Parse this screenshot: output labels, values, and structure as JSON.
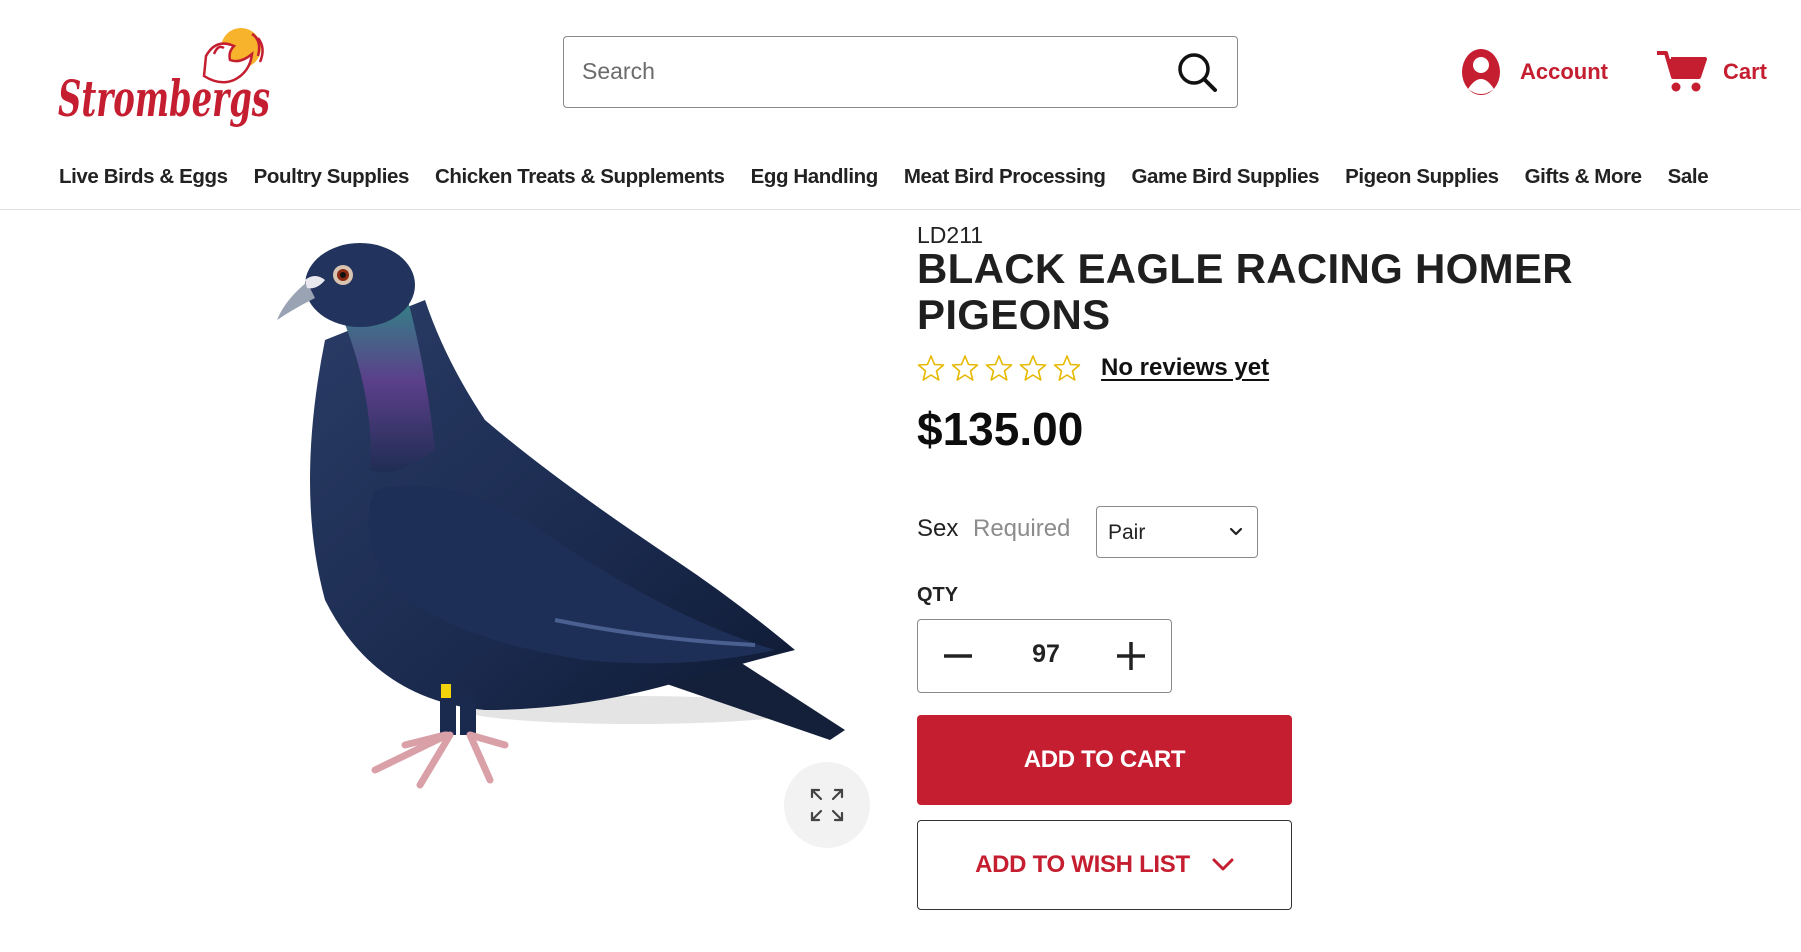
{
  "header": {
    "logo_text": "Strombergs",
    "search": {
      "placeholder": "Search"
    },
    "account_label": "Account",
    "cart_label": "Cart"
  },
  "nav": {
    "items": [
      "Live Birds & Eggs",
      "Poultry Supplies",
      "Chicken Treats & Supplements",
      "Egg Handling",
      "Meat Bird Processing",
      "Game Bird Supplies",
      "Pigeon Supplies",
      "Gifts & More",
      "Sale"
    ]
  },
  "product": {
    "sku": "LD211",
    "title": "BLACK EAGLE RACING HOMER PIGEONS",
    "rating": {
      "stars_filled": 0,
      "stars_total": 5,
      "reviews_text": "No reviews yet"
    },
    "price": "$135.00",
    "image_icon": "pigeon-image",
    "options": {
      "sex_label": "Sex",
      "sex_required": "Required",
      "sex_selected": "Pair"
    },
    "qty_label": "QTY",
    "qty_value": "97",
    "add_to_cart": "ADD TO CART",
    "add_to_wishlist": "ADD TO WISH LIST"
  },
  "colors": {
    "brand_red": "#c41e30",
    "star_outline": "#e6b800",
    "text_dark": "#1f1f1f"
  }
}
